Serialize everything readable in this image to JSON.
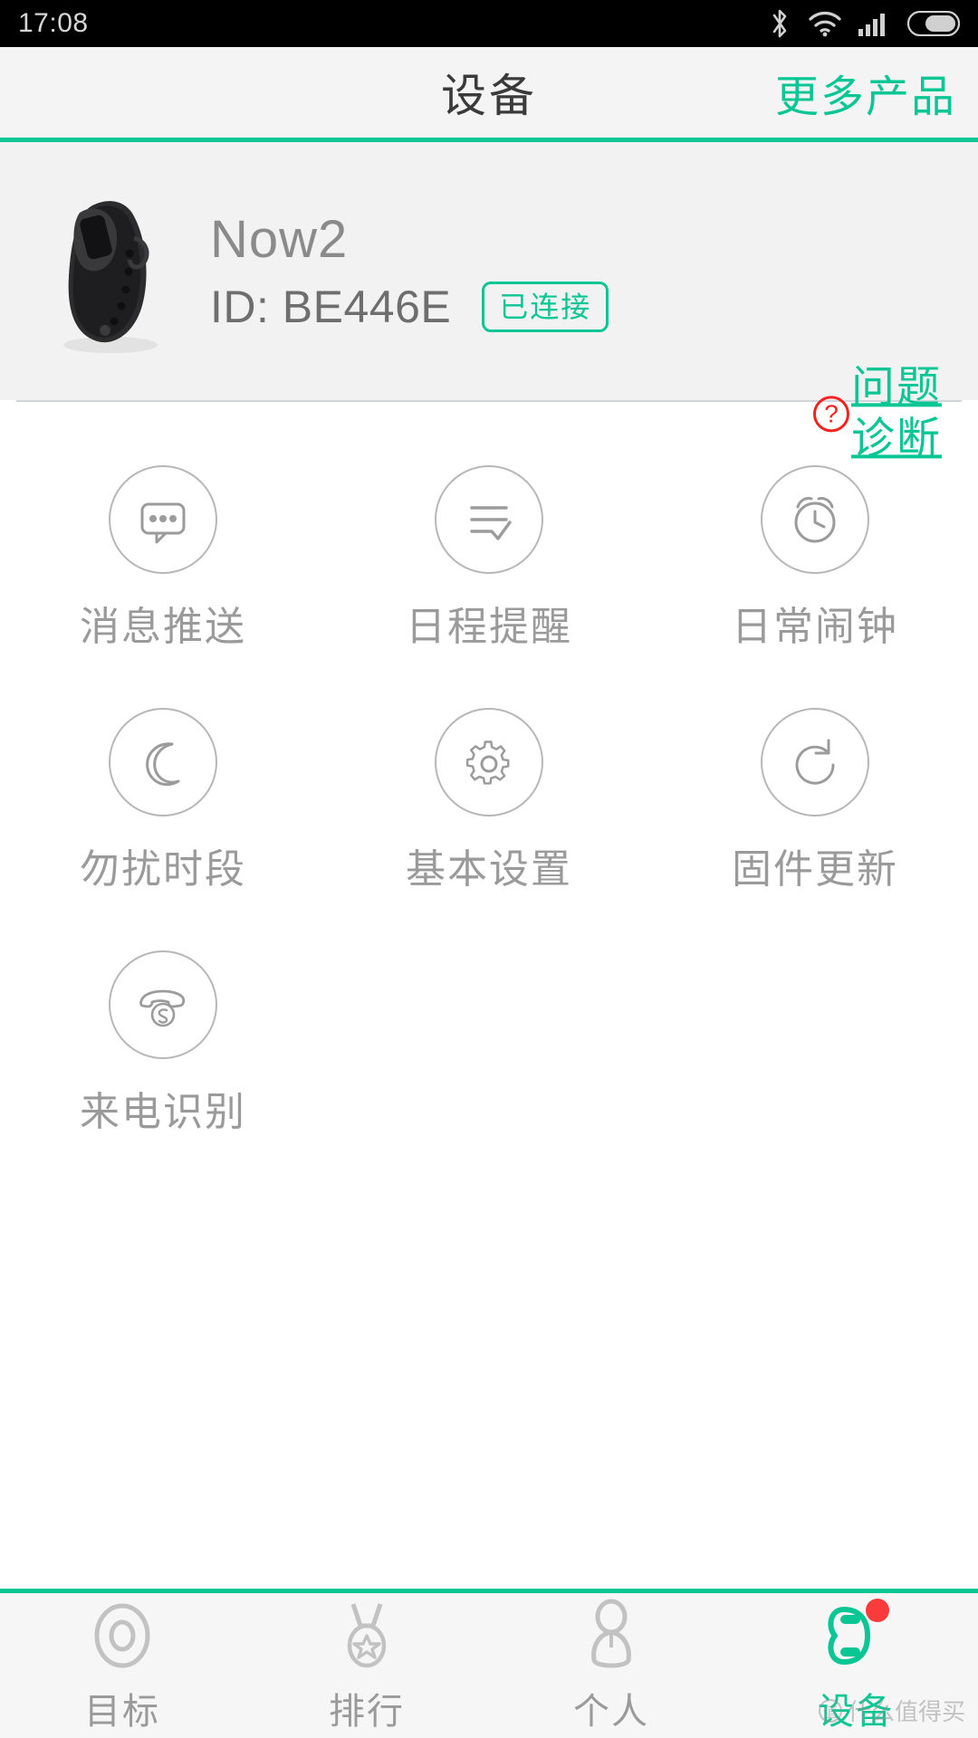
{
  "status_bar": {
    "time": "17:08",
    "icons": [
      "bluetooth-icon",
      "wifi-icon",
      "cellular-signal-icon",
      "battery-icon"
    ]
  },
  "header": {
    "title": "设备",
    "action_label": "更多产品",
    "accent_color": "#0ac694"
  },
  "device_card": {
    "name": "Now2",
    "id_label": "ID: BE446E",
    "connection_badge": "已连接",
    "diagnose_line1": "问题",
    "diagnose_line2": "诊断",
    "question_mark": "?",
    "question_color": "#f4231f",
    "product_image": "fitness-band-image"
  },
  "features": [
    {
      "label": "消息推送",
      "icon": "message-push-icon"
    },
    {
      "label": "日程提醒",
      "icon": "schedule-reminder-icon"
    },
    {
      "label": "日常闹钟",
      "icon": "alarm-clock-icon"
    },
    {
      "label": "勿扰时段",
      "icon": "do-not-disturb-moon-icon"
    },
    {
      "label": "基本设置",
      "icon": "settings-gear-icon"
    },
    {
      "label": "固件更新",
      "icon": "firmware-update-refresh-icon"
    },
    {
      "label": "来电识别",
      "icon": "incoming-call-icon"
    }
  ],
  "tabbar": {
    "items": [
      {
        "label": "目标",
        "icon": "goal-target-icon",
        "active": false,
        "badge": false
      },
      {
        "label": "排行",
        "icon": "ranking-medal-icon",
        "active": false,
        "badge": false
      },
      {
        "label": "个人",
        "icon": "person-profile-icon",
        "active": false,
        "badge": false
      },
      {
        "label": "设备",
        "icon": "device-band-icon",
        "active": true,
        "badge": true
      }
    ],
    "active_color": "#0ac694",
    "inactive_color": "#c2c2c2"
  },
  "watermark": {
    "text": "什么值得买"
  }
}
